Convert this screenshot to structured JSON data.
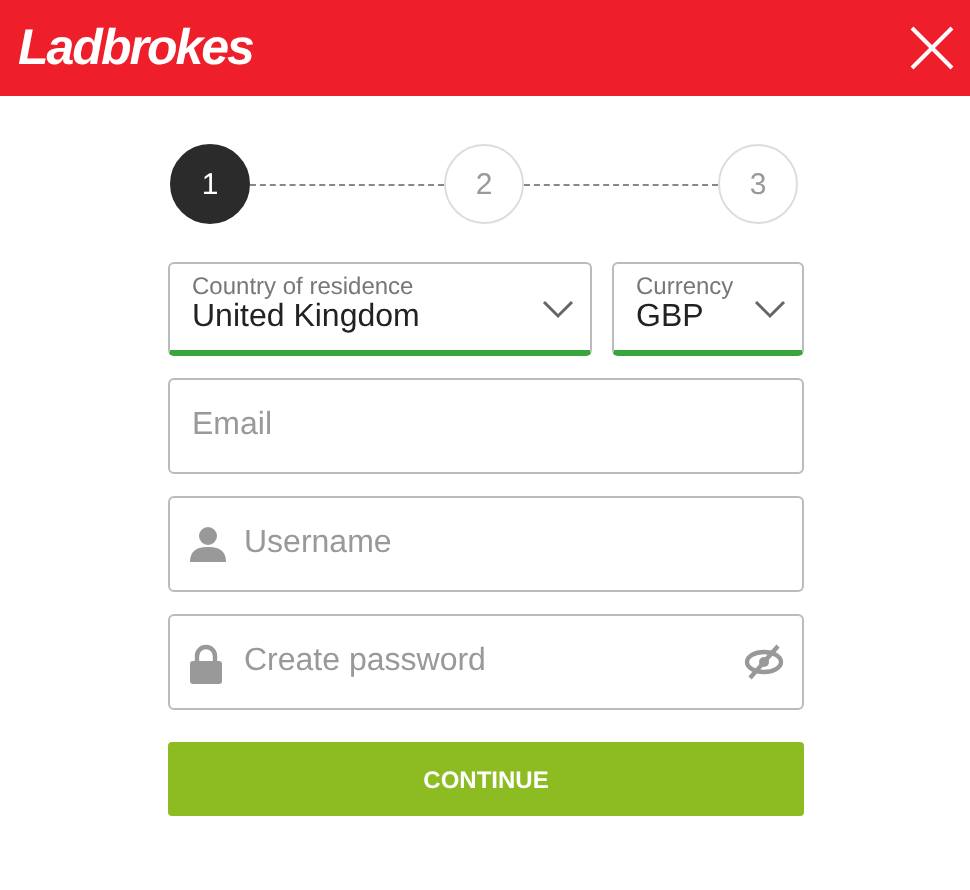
{
  "header": {
    "logo": "Ladbrokes"
  },
  "steps": [
    {
      "label": "1",
      "selected": true
    },
    {
      "label": "2",
      "selected": false
    },
    {
      "label": "3",
      "selected": false
    }
  ],
  "selects": [
    {
      "label": "Country of residence",
      "value": "United Kingdom",
      "valid": true
    },
    {
      "label": "Currency",
      "value": "GBP",
      "valid": true
    }
  ],
  "fields": [
    {
      "kind": "email",
      "placeholder": "Email"
    },
    {
      "kind": "username",
      "placeholder": "Username"
    },
    {
      "kind": "password",
      "placeholder": "Create password"
    }
  ],
  "button": "CONTINUE"
}
